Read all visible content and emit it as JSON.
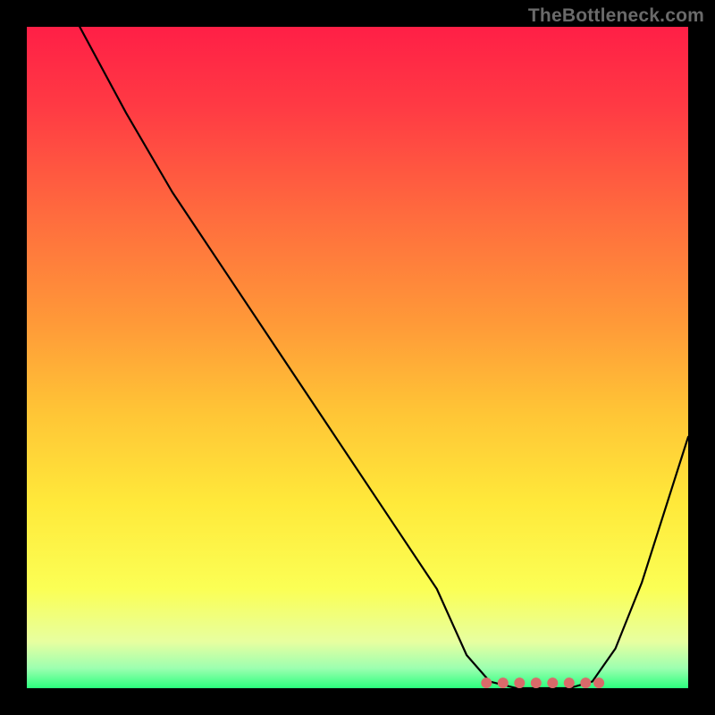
{
  "watermark": "TheBottleneck.com",
  "colors": {
    "background_black": "#000000",
    "curve": "#000000",
    "marker": "#d96a6a",
    "gradient_stops": [
      {
        "offset": 0.0,
        "color": "#ff1f46"
      },
      {
        "offset": 0.12,
        "color": "#ff3a44"
      },
      {
        "offset": 0.28,
        "color": "#ff6a3e"
      },
      {
        "offset": 0.45,
        "color": "#ff9a38"
      },
      {
        "offset": 0.58,
        "color": "#ffc436"
      },
      {
        "offset": 0.72,
        "color": "#ffe93a"
      },
      {
        "offset": 0.85,
        "color": "#fbff55"
      },
      {
        "offset": 0.93,
        "color": "#e7ffa0"
      },
      {
        "offset": 0.97,
        "color": "#9cffb0"
      },
      {
        "offset": 1.0,
        "color": "#2bff7d"
      }
    ]
  },
  "chart_data": {
    "type": "line",
    "title": "",
    "xlabel": "",
    "ylabel": "",
    "description": "Bottleneck-style curve: y is a mismatch/penalty metric (high=red=bad, low=green=good) plotted over an implicit x range. The minimum (optimal zone) is a flat trough roughly at x≈0.70–0.85 where y≈0.",
    "x_range": [
      0,
      1
    ],
    "y_range": [
      0,
      100
    ],
    "line_style": "V-shaped with flat trough; left descent is long and nearly linear, right ascent is shorter and steeper.",
    "points": [
      {
        "x": 0.08,
        "y": 100
      },
      {
        "x": 0.15,
        "y": 87
      },
      {
        "x": 0.22,
        "y": 75
      },
      {
        "x": 0.3,
        "y": 63
      },
      {
        "x": 0.38,
        "y": 51
      },
      {
        "x": 0.46,
        "y": 39
      },
      {
        "x": 0.54,
        "y": 27
      },
      {
        "x": 0.62,
        "y": 15
      },
      {
        "x": 0.665,
        "y": 5
      },
      {
        "x": 0.7,
        "y": 1
      },
      {
        "x": 0.74,
        "y": 0
      },
      {
        "x": 0.78,
        "y": 0
      },
      {
        "x": 0.82,
        "y": 0
      },
      {
        "x": 0.855,
        "y": 1
      },
      {
        "x": 0.89,
        "y": 6
      },
      {
        "x": 0.93,
        "y": 16
      },
      {
        "x": 0.965,
        "y": 27
      },
      {
        "x": 1.0,
        "y": 38
      }
    ],
    "optimal_markers_x": [
      0.695,
      0.72,
      0.745,
      0.77,
      0.795,
      0.82,
      0.845,
      0.865
    ],
    "marker_radius_px": 6
  }
}
